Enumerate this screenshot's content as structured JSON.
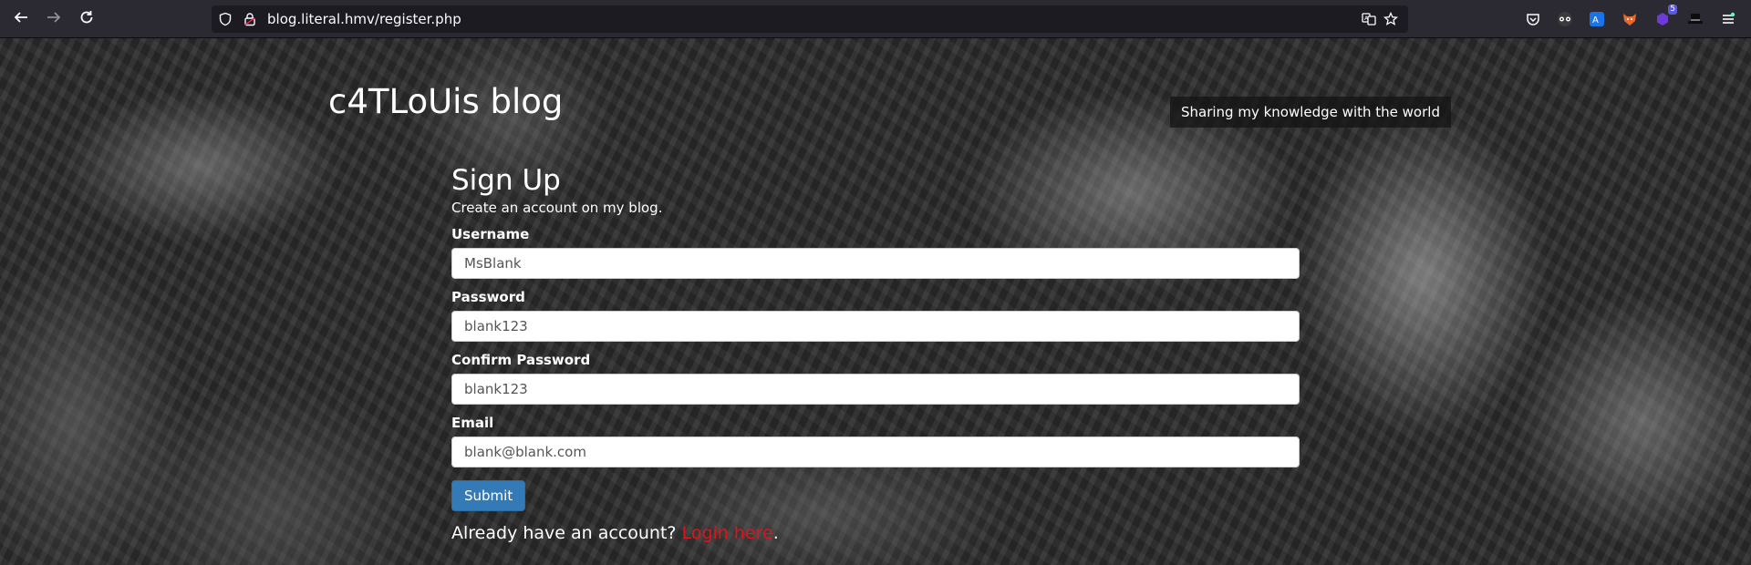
{
  "browser": {
    "url": "blog.literal.hmv/register.php",
    "nav": {
      "back_icon": "arrow-left-icon",
      "forward_icon": "arrow-right-icon",
      "reload_icon": "reload-icon"
    },
    "extensions": [
      {
        "name": "pocket-icon"
      },
      {
        "name": "tracker-icon"
      },
      {
        "name": "translate-icon"
      },
      {
        "name": "fox-icon"
      },
      {
        "name": "extension-badge-icon",
        "badge": "5"
      },
      {
        "name": "hat-icon"
      },
      {
        "name": "menu-icon"
      }
    ]
  },
  "site": {
    "title": "c4TLoUis blog",
    "tagline": "Sharing my knowledge with the world"
  },
  "form": {
    "heading": "Sign Up",
    "subtitle": "Create an account on my blog.",
    "fields": [
      {
        "label": "Username",
        "value": "MsBlank"
      },
      {
        "label": "Password",
        "value": "blank123"
      },
      {
        "label": "Confirm Password",
        "value": "blank123"
      },
      {
        "label": "Email",
        "value": "blank@blank.com"
      }
    ],
    "submit_label": "Submit",
    "login_prompt": "Already have an account? ",
    "login_link": "Login here",
    "login_suffix": "."
  },
  "colors": {
    "button": "#337ab7",
    "link": "#e0141b",
    "toolbar": "#2b2a33"
  }
}
